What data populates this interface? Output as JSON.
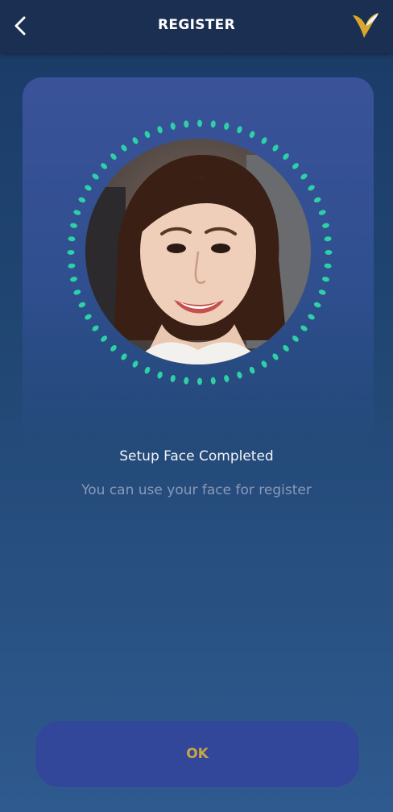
{
  "header": {
    "title": "REGISTER",
    "back_icon": "chevron-left-icon",
    "logo_icon": "bird-logo-icon"
  },
  "face_setup": {
    "ring_color": "#2ed0a6",
    "title": "Setup Face Completed",
    "subtitle": "You can use your face for register"
  },
  "actions": {
    "ok_label": "OK"
  },
  "colors": {
    "header_bg": "#1b2f52",
    "card_bg": "#3a5299",
    "button_bg": "#33479a",
    "button_text": "#c9a546",
    "logo_gold": "#d9a72b"
  }
}
